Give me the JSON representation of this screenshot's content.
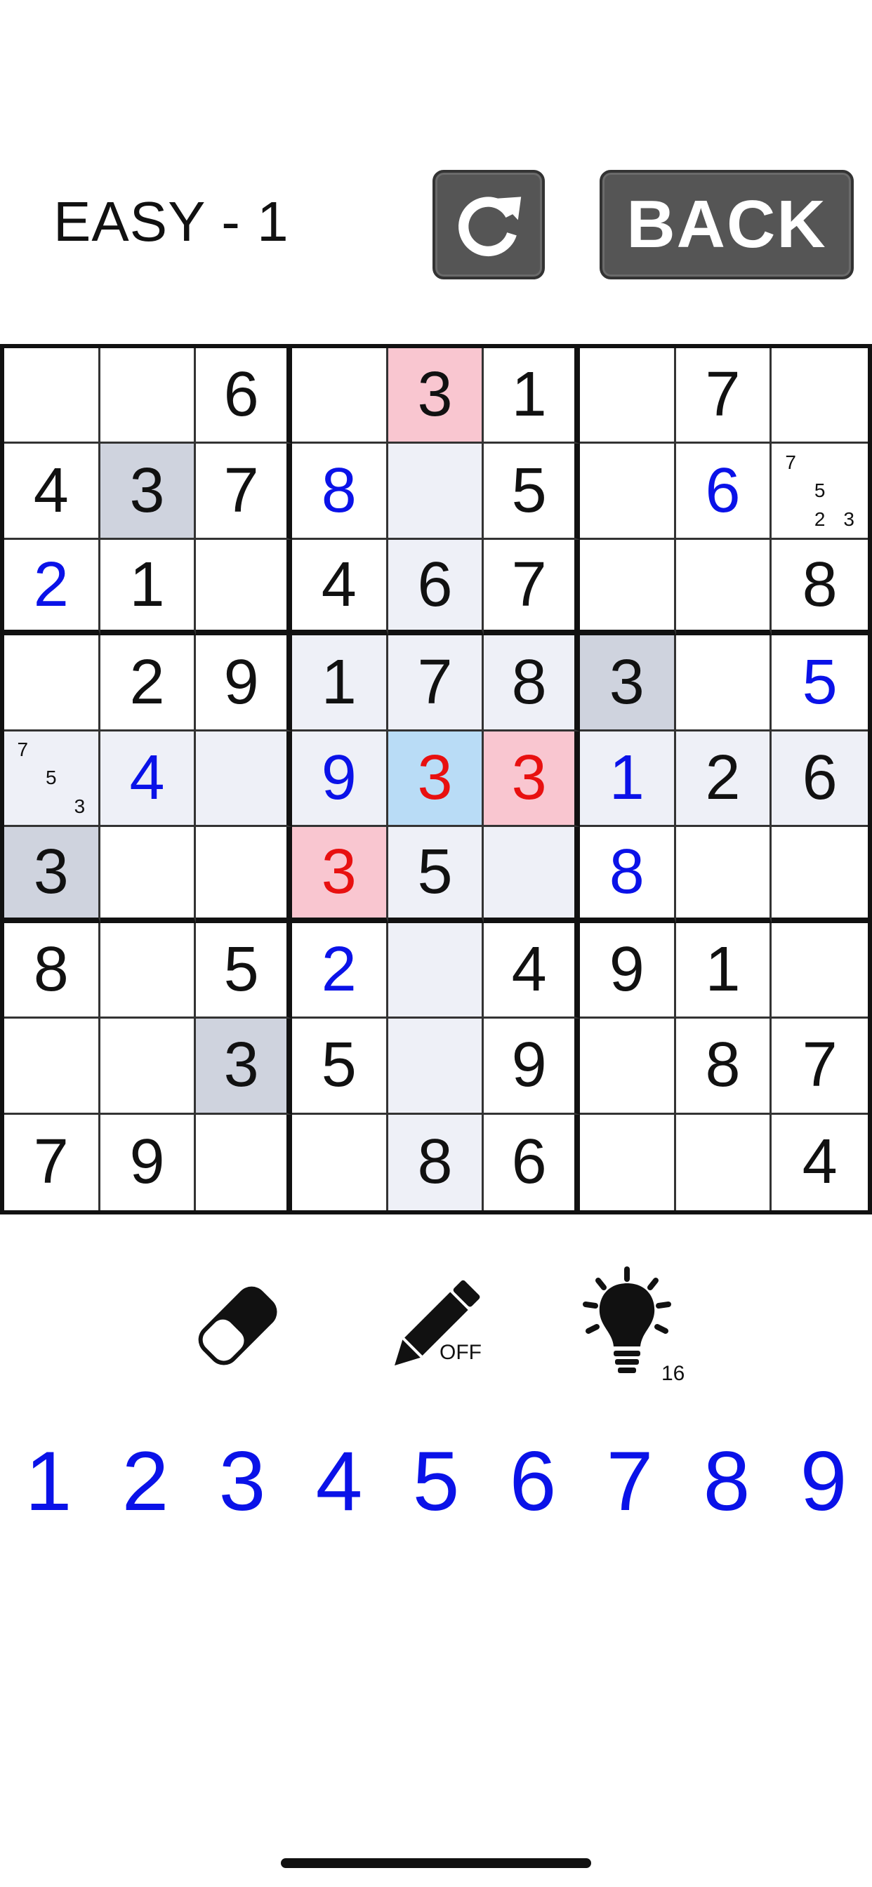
{
  "header": {
    "level_title": "EASY - 1",
    "back_label": "BACK"
  },
  "board": {
    "rows": [
      [
        "",
        "",
        "6",
        "",
        "3",
        "1",
        "",
        "7",
        ""
      ],
      [
        "4",
        "3",
        "7",
        "8",
        "",
        "5",
        "",
        "6",
        ""
      ],
      [
        "2",
        "1",
        "",
        "4",
        "6",
        "7",
        "",
        "",
        "8"
      ],
      [
        "",
        "2",
        "9",
        "1",
        "7",
        "8",
        "3",
        "",
        "5"
      ],
      [
        "",
        "4",
        "",
        "9",
        "3",
        "3",
        "1",
        "2",
        "6"
      ],
      [
        "3",
        "",
        "",
        "3",
        "5",
        "",
        "8",
        "",
        ""
      ],
      [
        "8",
        "",
        "5",
        "2",
        "",
        "4",
        "9",
        "1",
        ""
      ],
      [
        "",
        "",
        "3",
        "5",
        "",
        "9",
        "",
        "8",
        "7"
      ],
      [
        "7",
        "9",
        "",
        "",
        "8",
        "6",
        "",
        "",
        "4"
      ]
    ],
    "notes": {
      "1-8": [
        "7",
        "",
        "",
        "",
        "5",
        "",
        "",
        "2",
        "3"
      ],
      "4-0": [
        "7",
        "",
        "",
        "",
        "5",
        "",
        "",
        "",
        "3"
      ]
    },
    "user_entered": [
      "1-3",
      "1-7",
      "2-0",
      "3-8",
      "4-1",
      "4-3",
      "4-6",
      "5-6",
      "6-3"
    ],
    "error_cells": [
      "4-4",
      "4-5",
      "5-3"
    ],
    "selected_cell": "4-4",
    "highlight_same": [
      "1-1",
      "3-6",
      "5-0",
      "7-2"
    ],
    "highlight_conflict": [
      "0-4",
      "4-5",
      "5-3"
    ],
    "colors": {
      "user_digit": "#0a12e8",
      "error_digit": "#e81010",
      "selected_bg": "#b9dcf6",
      "conflict_bg": "#f9c6d0",
      "same_bg": "#cfd3de",
      "related_bg": "#eef0f7"
    }
  },
  "tools": {
    "eraser_icon": "eraser-icon",
    "pencil_icon": "pencil-icon",
    "pencil_state": "OFF",
    "hint_icon": "lightbulb-icon",
    "hint_count": "16"
  },
  "numpad": [
    "1",
    "2",
    "3",
    "4",
    "5",
    "6",
    "7",
    "8",
    "9"
  ]
}
